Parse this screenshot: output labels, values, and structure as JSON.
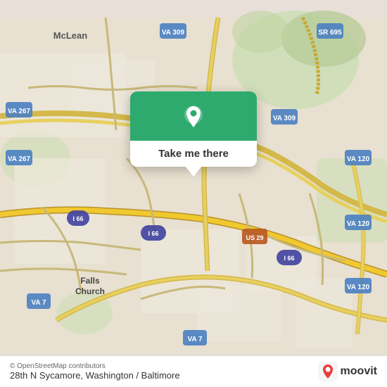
{
  "map": {
    "alt": "OpenStreetMap of Falls Church / McLean area, Virginia",
    "copyright": "© OpenStreetMap contributors",
    "location_label": "28th N Sycamore, Washington / Baltimore",
    "moovit_label": "moovit"
  },
  "popup": {
    "button_label": "Take me there",
    "pin_icon": "location-pin"
  },
  "road_labels": [
    "McLean",
    "SR 695",
    "VA 309",
    "VA 267",
    "I 66",
    "VA 7",
    "US 29",
    "VA 120",
    "Falls Church",
    "VA 267"
  ]
}
